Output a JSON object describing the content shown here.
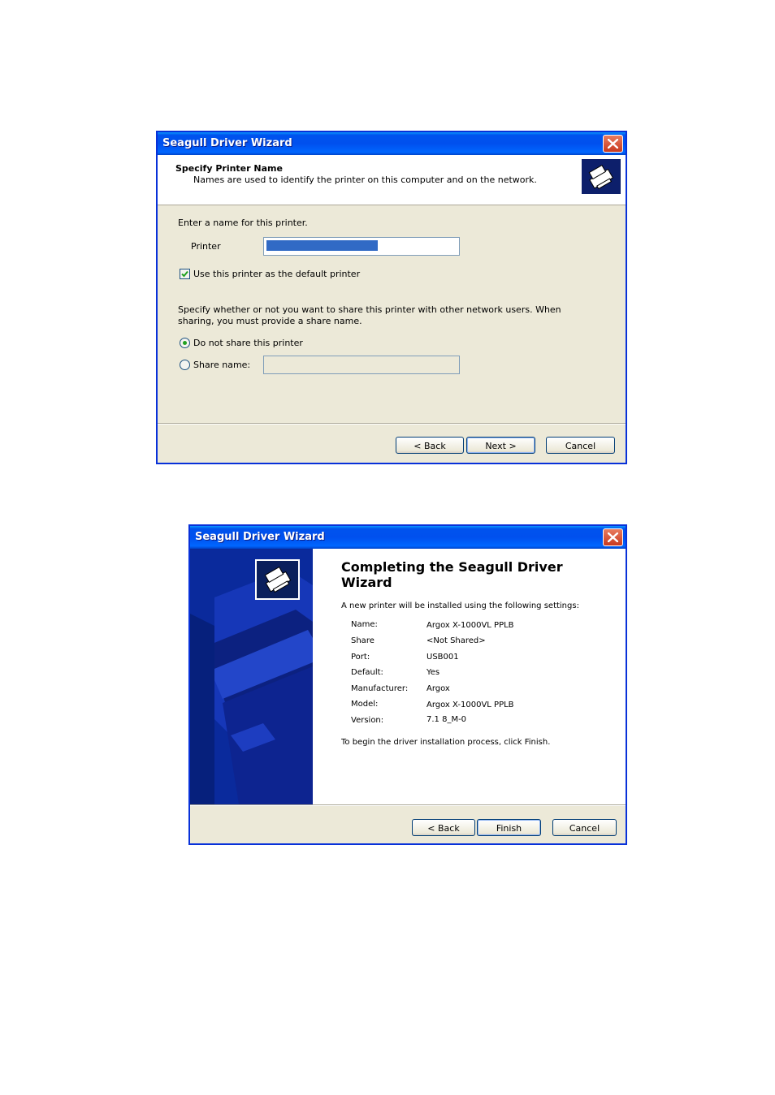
{
  "wizard1": {
    "title": "Seagull Driver Wizard",
    "header_title": "Specify Printer Name",
    "header_subtitle": "Names are used to identify the printer on this computer and on the network.",
    "prompt": "Enter a name for this printer.",
    "printer_label": "Printer",
    "printer_value": "",
    "default_checkbox_label": "Use this printer as the default printer",
    "default_checked": true,
    "share_instructions_line1": "Specify whether or not you want to share this printer with other network users.  When",
    "share_instructions_line2": "sharing, you must provide a share name.",
    "radio_no_share": "Do not share this printer",
    "radio_share": "Share name:",
    "share_name_value": "",
    "buttons": {
      "back": "< Back",
      "next": "Next >",
      "cancel": "Cancel"
    }
  },
  "wizard2": {
    "title": "Seagull Driver Wizard",
    "heading_line1": "Completing the Seagull Driver",
    "heading_line2": "Wizard",
    "intro": "A new printer will be installed using the following settings:",
    "settings": [
      {
        "label": "Name:",
        "value": "Argox X-1000VL PPLB"
      },
      {
        "label": "Share",
        "value": "<Not Shared>"
      },
      {
        "label": "Port:",
        "value": "USB001"
      },
      {
        "label": "Default:",
        "value": "Yes"
      },
      {
        "label": "Manufacturer:",
        "value": "Argox"
      },
      {
        "label": "Model:",
        "value": "Argox X-1000VL PPLB"
      },
      {
        "label": "Version:",
        "value": "7.1 8_M-0"
      }
    ],
    "finish_note": "To begin the driver installation process, click Finish.",
    "buttons": {
      "back": "< Back",
      "finish": "Finish",
      "cancel": "Cancel"
    }
  },
  "colors": {
    "titlebar_blue": "#0054e3",
    "dialog_face": "#ece9d8",
    "wizard_panel_blue": "#0a2a9c",
    "close_red": "#d9542f"
  },
  "icons": [
    "close-icon",
    "printer-icon",
    "checkmark-icon"
  ]
}
